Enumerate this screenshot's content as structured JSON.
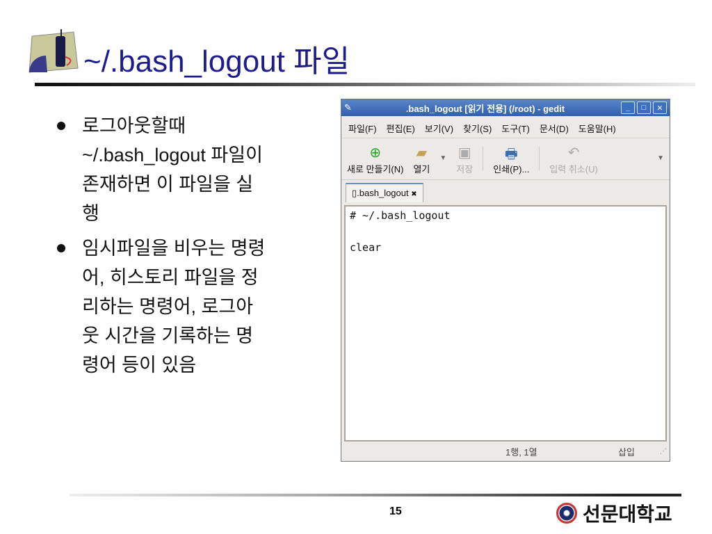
{
  "title": "~/.bash_logout 파일",
  "bullets": [
    {
      "lines": [
        "로그아웃할때",
        "~/.bash_logout 파일이",
        "존재하면 이 파일을 실",
        "행"
      ]
    },
    {
      "lines": [
        "임시파일을 비우는 명령",
        "어, 히스토리 파일을 정",
        "리하는 명령어, 로그아",
        "웃 시간을 기록하는 명",
        "령어 등이 있음"
      ]
    }
  ],
  "window": {
    "title": ".bash_logout [읽기 전용] (/root) - gedit",
    "menu": [
      "파일(F)",
      "편집(E)",
      "보기(V)",
      "찾기(S)",
      "도구(T)",
      "문서(D)",
      "도움말(H)"
    ],
    "toolbar": {
      "new": "새로 만들기(N)",
      "open": "열기",
      "save": "저장",
      "print": "인쇄(P)...",
      "undo": "입력 취소(U)"
    },
    "tab": ".bash_logout",
    "content": "# ~/.bash_logout\n\nclear",
    "status": {
      "position": "1행, 1열",
      "mode": "삽입"
    }
  },
  "page_number": "15",
  "logo_text": "선문대학교"
}
